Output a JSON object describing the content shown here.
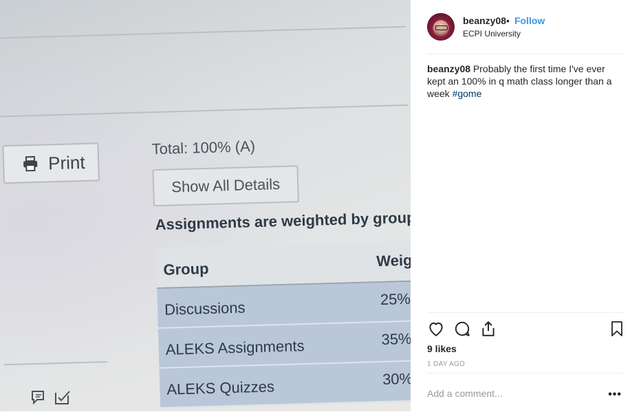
{
  "photo": {
    "print_label": "Print",
    "total_text": "Total: 100% (A)",
    "show_all_label": "Show All Details",
    "weighted_text": "Assignments are weighted by group:",
    "table": {
      "headers": [
        "Group",
        "Weig"
      ],
      "rows": [
        {
          "group": "Discussions",
          "weight": "25%"
        },
        {
          "group": "ALEKS Assignments",
          "weight": "35%"
        },
        {
          "group": "ALEKS Quizzes",
          "weight": "30%"
        }
      ]
    }
  },
  "post": {
    "username": "beanzy08",
    "separator": "•",
    "follow_label": "Follow",
    "location": "ECPI University",
    "caption_user": "beanzy08",
    "caption_text": " Probably the first time I've ever kept an 100% in q math class longer than a week ",
    "hashtag": "#gome",
    "likes": "9 likes",
    "time_ago": "1 DAY AGO",
    "comment_placeholder": "Add a comment...",
    "more_label": "•••"
  }
}
